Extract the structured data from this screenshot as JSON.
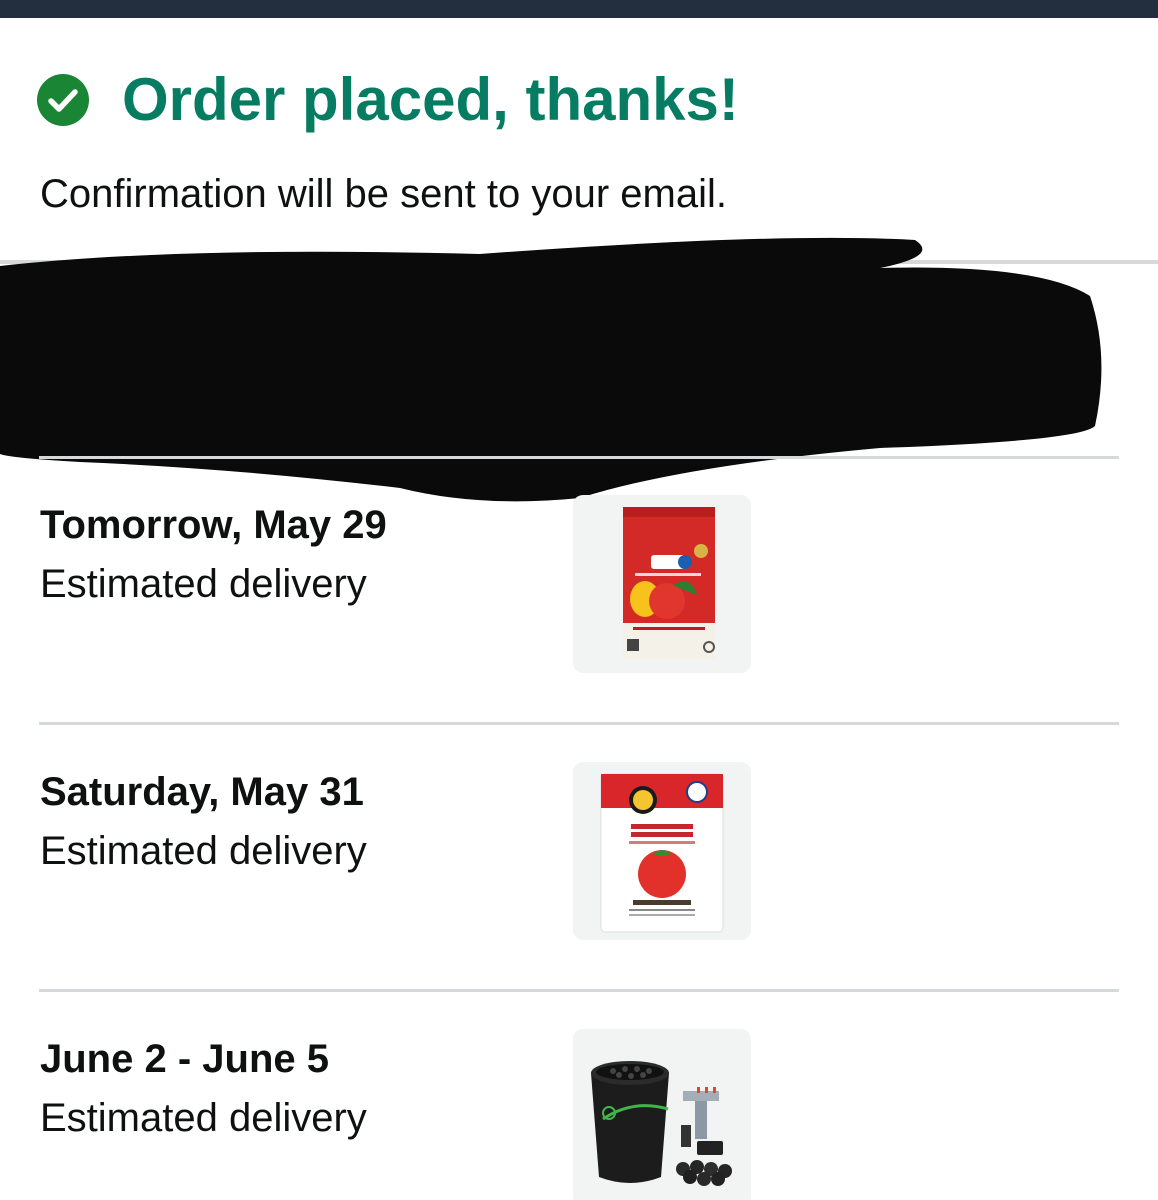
{
  "header": {
    "title": "Order placed, thanks!",
    "subtitle": "Confirmation will be sent to your email."
  },
  "colors": {
    "success": "#067d62",
    "check_icon": "#1b8536",
    "top_bar": "#232f3e",
    "divider": "#d5d9d9"
  },
  "shipments": [
    {
      "date": "Tomorrow, May 29",
      "status": "Estimated delivery",
      "product_image": "tomato-vegetable-organic-fertilizer-bag"
    },
    {
      "date": "Saturday, May 31",
      "status": "Estimated delivery",
      "product_image": "tomato-vegetable-plant-food-bag"
    },
    {
      "date": "June 2 - June 5",
      "status": "Estimated delivery",
      "product_image": "hydroponic-bucket-system"
    }
  ]
}
